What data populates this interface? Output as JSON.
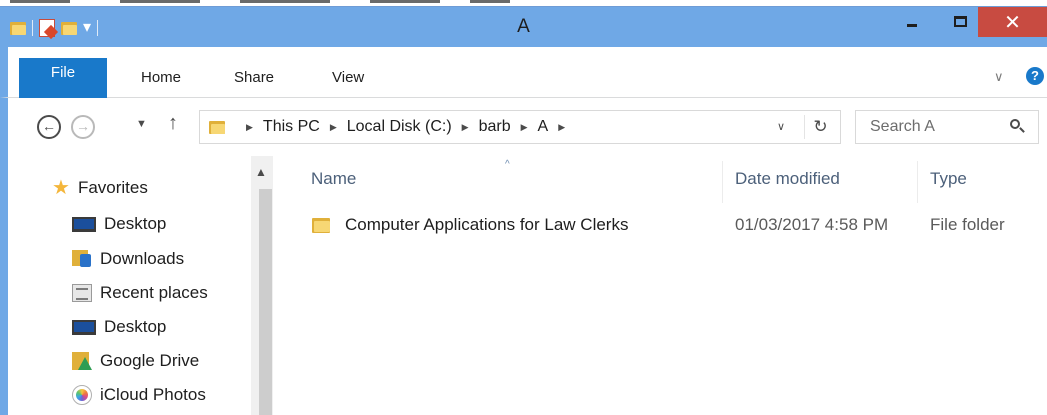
{
  "window": {
    "title": "A",
    "close_glyph": "✕"
  },
  "quick_access_toolbar": {
    "dropdown_glyph": "▾"
  },
  "ribbon": {
    "tabs": [
      {
        "label": "File",
        "active": true
      },
      {
        "label": "Home"
      },
      {
        "label": "Share"
      },
      {
        "label": "View"
      }
    ],
    "expand_glyph": "∨",
    "help_glyph": "?"
  },
  "navigation": {
    "back_glyph": "←",
    "forward_glyph": "→",
    "recent_glyph": "▼",
    "up_glyph": "↑"
  },
  "address_bar": {
    "breadcrumb": [
      "This PC",
      "Local Disk (C:)",
      "barb",
      "A"
    ],
    "separator": "▶",
    "dropdown_glyph": "∨",
    "refresh_glyph": "↻"
  },
  "search": {
    "placeholder": "Search A"
  },
  "nav_pane": {
    "scroll_up_glyph": "▲",
    "favorites_label": "Favorites",
    "items": [
      {
        "label": "Desktop",
        "icon": "desktop-icon"
      },
      {
        "label": "Downloads",
        "icon": "downloads-icon"
      },
      {
        "label": "Recent places",
        "icon": "recent-places-icon"
      },
      {
        "label": "Desktop",
        "icon": "desktop-icon"
      },
      {
        "label": "Google Drive",
        "icon": "google-drive-icon"
      },
      {
        "label": "iCloud Photos",
        "icon": "icloud-photos-icon"
      }
    ]
  },
  "file_list": {
    "sort_glyph": "^",
    "columns": {
      "name": "Name",
      "date": "Date modified",
      "type": "Type"
    },
    "rows": [
      {
        "name": "Computer Applications for Law Clerks",
        "date": "01/03/2017 4:58 PM",
        "type": "File folder"
      }
    ]
  },
  "colors": {
    "title_bar": "#6fa8e6",
    "file_tab": "#1979ca",
    "close_button": "#c84b41",
    "header_text": "#4c607a"
  }
}
